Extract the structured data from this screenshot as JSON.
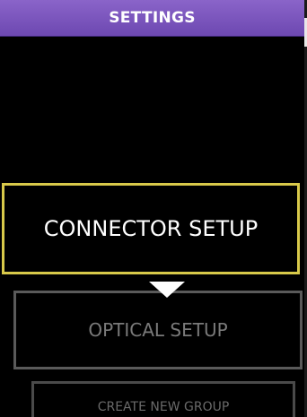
{
  "header": {
    "title": "SETTINGS"
  },
  "menu": {
    "items": [
      {
        "label": "CONNECTOR SETUP",
        "state": "selected"
      },
      {
        "label": "OPTICAL SETUP",
        "state": "inactive"
      },
      {
        "label": "CREATE NEW GROUP",
        "state": "inactive"
      }
    ]
  },
  "colors": {
    "header_bg": "#7a55bd",
    "selected_border": "#d8c94a",
    "inactive_border": "#5a5a5a",
    "inactive_text": "#7a7a7a"
  }
}
